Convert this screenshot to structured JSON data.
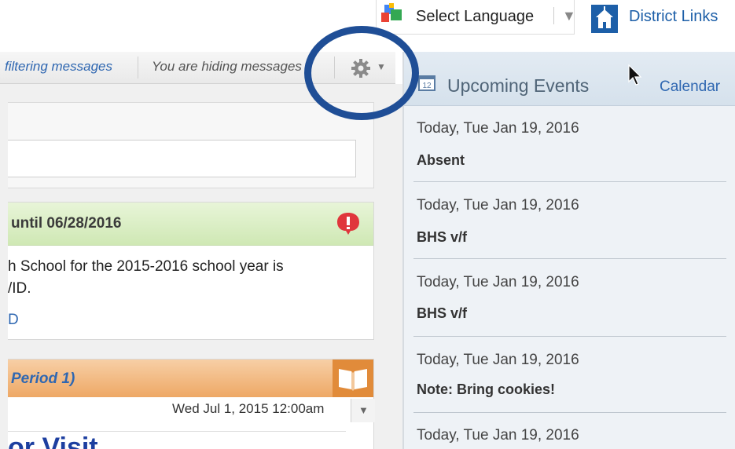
{
  "top_bar": {
    "language_label": "Select Language",
    "language_arrow": "▼",
    "district_label": "District Links"
  },
  "toolbar": {
    "filter_label": "filtering messages",
    "hiding_label": "You are hiding messages",
    "gear_arrow": "▼"
  },
  "alert_card": {
    "title": "until 06/28/2016",
    "body_line1": "h School for the 2015-2016 school year is",
    "body_line2": "/ID.",
    "link_text": "D"
  },
  "period_card": {
    "title": "Period 1)",
    "date": "Wed Jul 1, 2015 12:00am",
    "dropdown_arrow": "▼",
    "visit_title": "or Visit"
  },
  "events": {
    "title": "Upcoming Events",
    "calendar_link": "Calendar",
    "items": [
      {
        "date": "Today, Tue Jan 19, 2016",
        "name": "Absent"
      },
      {
        "date": "Today, Tue Jan 19, 2016",
        "name": "BHS v/f"
      },
      {
        "date": "Today, Tue Jan 19, 2016",
        "name": "BHS v/f"
      },
      {
        "date": "Today, Tue Jan 19, 2016",
        "name": "Note: Bring cookies!"
      },
      {
        "date": "Today, Tue Jan 19, 2016",
        "name": ""
      }
    ]
  },
  "colors": {
    "link_blue": "#2f67b1",
    "annotation_circle": "#1f4e96",
    "alert_red": "#e0363c",
    "period_orange": "#e18b3a"
  }
}
